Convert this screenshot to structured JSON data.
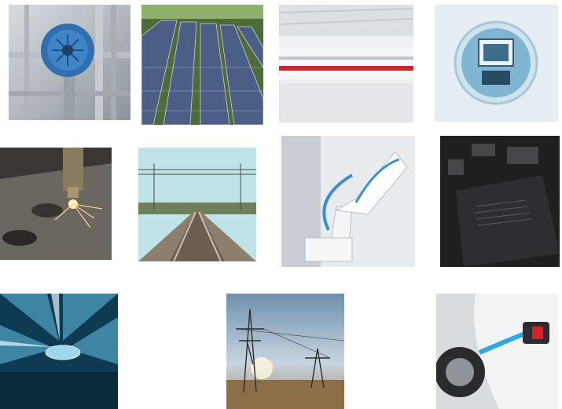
{
  "gallery": {
    "tiles": [
      {
        "name": "industrial-motor-photo"
      },
      {
        "name": "solar-panels-photo"
      },
      {
        "name": "high-speed-train-photo"
      },
      {
        "name": "electronic-device-photo"
      },
      {
        "name": "laser-cutting-photo"
      },
      {
        "name": "railway-tracks-photo"
      },
      {
        "name": "industrial-robot-arm-photo"
      },
      {
        "name": "circuit-chip-photo"
      },
      {
        "name": "car-headlight-photo"
      },
      {
        "name": "power-pylons-photo"
      },
      {
        "name": "ev-charging-photo"
      }
    ]
  }
}
